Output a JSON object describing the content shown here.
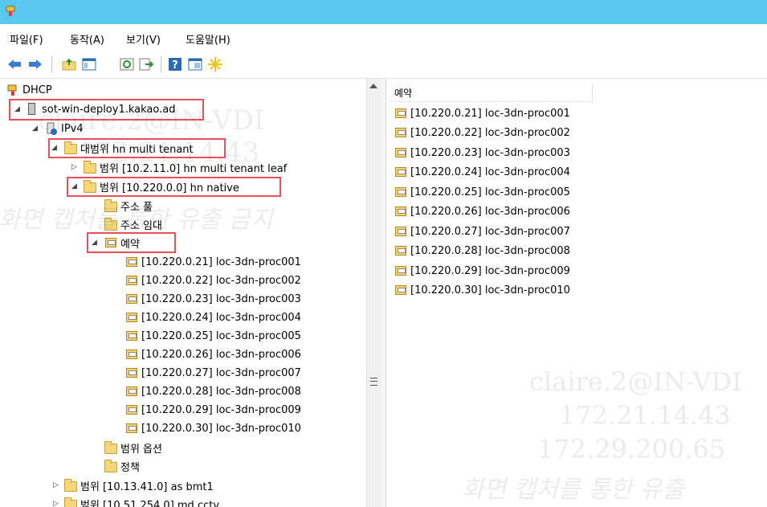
{
  "window": {
    "title": "",
    "accent": "#58c8f0",
    "highlight_color": "#e8505b"
  },
  "menu": [
    "파일(F)",
    "동작(A)",
    "보기(V)",
    "도움말(H)"
  ],
  "toolbar_icons": [
    "back-icon",
    "forward-icon",
    "up-folder-icon",
    "show-hide-tree-icon",
    "refresh-icon",
    "export-list-icon",
    "help-icon",
    "properties-icon",
    "action-star-icon"
  ],
  "tree": {
    "root": "DHCP",
    "server": "sot-win-deploy1.kakao.ad",
    "ipv4": "IPv4",
    "superscope": "대범위 hn multi tenant",
    "scope_leaf": "범위 [10.2.11.0] hn multi tenant leaf",
    "scope_native": "범위 [10.220.0.0] hn native",
    "address_pool": "주소 풀",
    "address_leases": "주소 임대",
    "reservations": "예약",
    "reservation_items": [
      "[10.220.0.21] loc-3dn-proc001",
      "[10.220.0.22] loc-3dn-proc002",
      "[10.220.0.23] loc-3dn-proc003",
      "[10.220.0.24] loc-3dn-proc004",
      "[10.220.0.25] loc-3dn-proc005",
      "[10.220.0.26] loc-3dn-proc006",
      "[10.220.0.27] loc-3dn-proc007",
      "[10.220.0.28] loc-3dn-proc008",
      "[10.220.0.29] loc-3dn-proc009",
      "[10.220.0.30] loc-3dn-proc010"
    ],
    "scope_options": "범위 옵션",
    "policies": "정책",
    "scope_bmt1": "범위 [10.13.41.0] as bmt1",
    "scope_cctv": "범위 [10.51.254.0] md cctv"
  },
  "list": {
    "column_header": "예약",
    "items": [
      "[10.220.0.21] loc-3dn-proc001",
      "[10.220.0.22] loc-3dn-proc002",
      "[10.220.0.23] loc-3dn-proc003",
      "[10.220.0.24] loc-3dn-proc004",
      "[10.220.0.25] loc-3dn-proc005",
      "[10.220.0.26] loc-3dn-proc006",
      "[10.220.0.27] loc-3dn-proc007",
      "[10.220.0.28] loc-3dn-proc008",
      "[10.220.0.29] loc-3dn-proc009",
      "[10.220.0.30] loc-3dn-proc010"
    ]
  },
  "watermark": {
    "left": [
      "claire.2@IN-VDI",
      "172.21.14.43",
      "화면 캡처를 통한 유출 금지"
    ],
    "right": [
      "claire.2@IN-VDI",
      "172.21.14.43",
      "172.29.200.65",
      "화면 캡처를 통한 유출"
    ]
  }
}
